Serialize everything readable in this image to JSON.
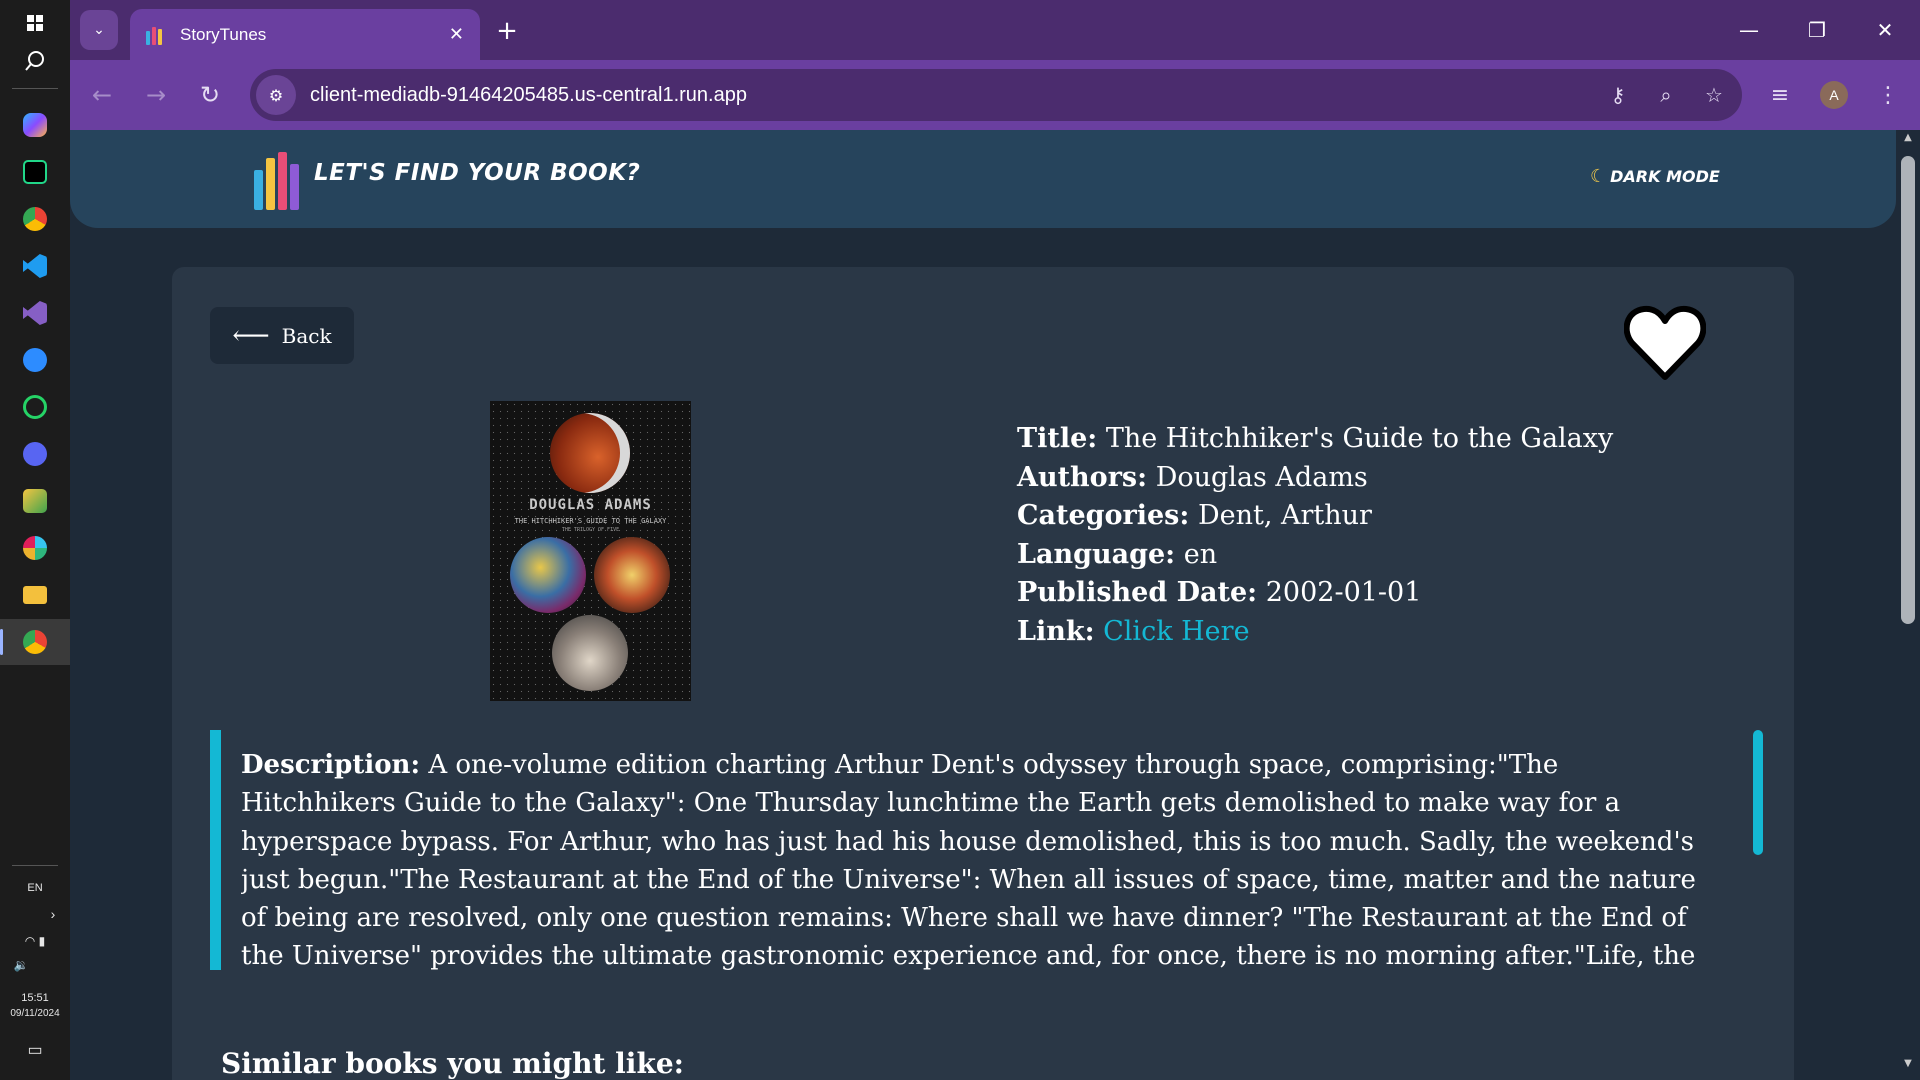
{
  "taskbar": {
    "language": "EN",
    "time": "15:51",
    "date": "09/11/2024"
  },
  "browser": {
    "tab_title": "StoryTunes",
    "url": "client-mediadb-91464205485.us-central1.run.app",
    "profile_initial": "A",
    "accent": "#6a3fa0"
  },
  "header": {
    "brand": "LET'S FIND YOUR BOOK?",
    "dark_mode_label": "DARK MODE"
  },
  "book": {
    "back_label": "Back",
    "title_label": "Title:",
    "title": "The Hitchhiker's Guide to the Galaxy",
    "authors_label": "Authors:",
    "authors": "Douglas Adams",
    "categories_label": "Categories:",
    "categories": "Dent, Arthur",
    "language_label": "Language:",
    "language": "en",
    "published_label": "Published Date:",
    "published": "2002-01-01",
    "link_label": "Link:",
    "link_text": "Click Here",
    "cover_author": "DOUGLAS ADAMS",
    "cover_title": "THE HITCHHIKER'S GUIDE TO THE GALAXY",
    "cover_subtitle": "THE TRILOGY OF FIVE",
    "description_label": "Description:",
    "description": "A one-volume edition charting Arthur Dent's odyssey through space, comprising:\"The Hitchhikers Guide to the Galaxy\": One Thursday lunchtime the Earth gets demolished to make way for a hyperspace bypass. For Arthur, who has just had his house demolished, this is too much. Sadly, the weekend's just begun.\"The Restaurant at the End of the Universe\": When all issues of space, time, matter and the nature of being are resolved, only one question remains: Where shall we have dinner? \"The Restaurant at the End of the Universe\" provides the ultimate gastronomic experience and, for once, there is no morning after.\"Life, the",
    "similar_heading": "Similar books you might like:"
  }
}
